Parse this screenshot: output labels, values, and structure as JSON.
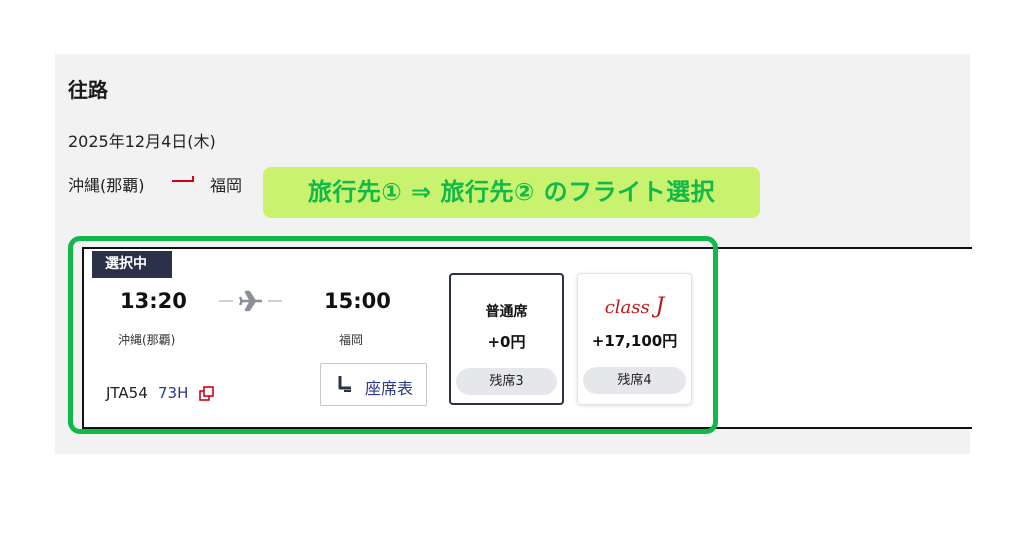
{
  "outbound": {
    "title": "往路",
    "date": "2025年12月4日(木)",
    "route_from": "沖縄(那覇)",
    "route_to": "福岡"
  },
  "callout": {
    "text": "旅行先① ⇒ 旅行先② のフライト選択"
  },
  "flight": {
    "selected_badge": "選択中",
    "departure_time": "13:20",
    "arrival_time": "15:00",
    "departure_place": "沖縄(那覇)",
    "arrival_place": "福岡",
    "flight_number": "JTA54",
    "aircraft": "73H",
    "seat_map_label": "座席表"
  },
  "fares": [
    {
      "name": "普通席",
      "price": "+0円",
      "remaining": "残席3"
    },
    {
      "logo": "class J",
      "price": "+17,100円",
      "remaining": "残席4"
    }
  ],
  "colors": {
    "accent_red": "#d0021b",
    "callout_bg": "#c9f36e",
    "callout_text": "#12b84a",
    "badge_bg": "#2b3148",
    "link_blue": "#2a3a8f"
  },
  "icons": [
    "plane-icon",
    "external-link-icon",
    "seat-icon",
    "route-arrow-icon"
  ]
}
